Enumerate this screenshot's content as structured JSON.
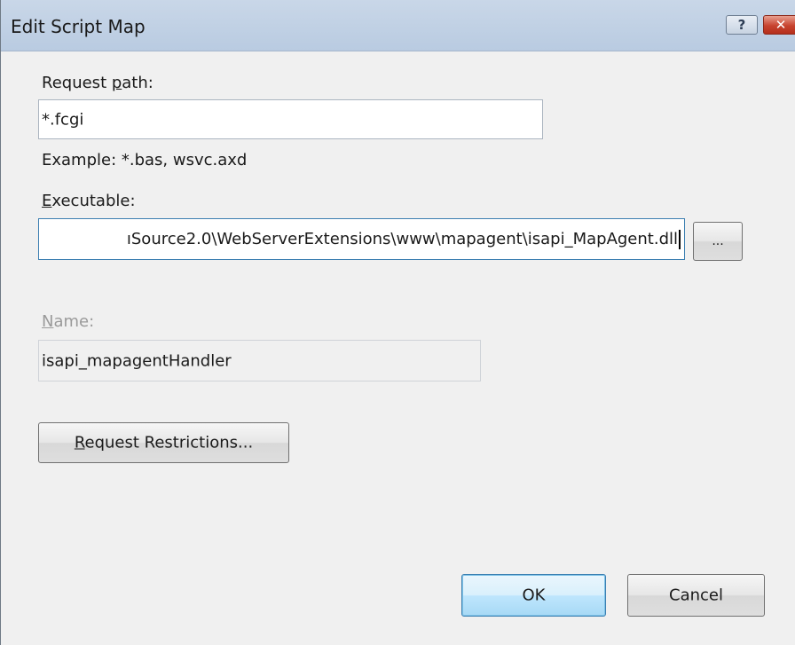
{
  "window": {
    "title": "Edit Script Map"
  },
  "titlebar": {
    "help_icon": "help-icon",
    "help_glyph": "?",
    "close_icon": "close-icon",
    "close_glyph": "✕"
  },
  "request_path": {
    "label_mnemonic": "R",
    "label_pre": "equest ",
    "label_underlined": "p",
    "label_post": "ath:",
    "value": "*.fcgi",
    "example": "Example: *.bas, wsvc.axd"
  },
  "executable": {
    "label_underlined": "E",
    "label_rest": "xecutable:",
    "value_visible": "ıSource2.0\\WebServerExtensions\\www\\mapagent\\isapi_MapAgent.dll",
    "browse_label": "..."
  },
  "name": {
    "label_underlined": "N",
    "label_rest": "ame:",
    "value": "isapi_mapagentHandler"
  },
  "buttons": {
    "restrictions_underlined": "R",
    "restrictions_rest": "equest Restrictions...",
    "ok": "OK",
    "cancel": "Cancel"
  }
}
